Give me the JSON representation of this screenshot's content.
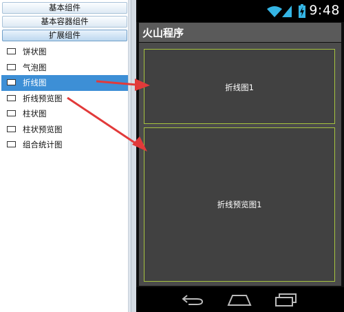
{
  "palette": {
    "categories": [
      {
        "label": "基本组件",
        "active": false
      },
      {
        "label": "基本容器组件",
        "active": false
      },
      {
        "label": "扩展组件",
        "active": true
      }
    ],
    "components": [
      {
        "label": "饼状图",
        "icon": "component-icon",
        "selected": false
      },
      {
        "label": "气泡图",
        "icon": "component-icon",
        "selected": false
      },
      {
        "label": "折线图",
        "icon": "component-icon",
        "selected": true
      },
      {
        "label": "折线预览图",
        "icon": "component-icon",
        "selected": false
      },
      {
        "label": "柱状图",
        "icon": "component-icon",
        "selected": false
      },
      {
        "label": "柱状预览图",
        "icon": "component-icon",
        "selected": false
      },
      {
        "label": "组合统计图",
        "icon": "component-icon",
        "selected": false
      }
    ]
  },
  "phone": {
    "status_bar": {
      "time": "9:48",
      "icons": [
        "wifi-icon",
        "signal-icon",
        "battery-charging-icon"
      ]
    },
    "app_title": "火山程序",
    "widgets": {
      "line_chart": "折线图1",
      "line_preview_chart": "折线预览图1"
    },
    "nav_icons": [
      "back-icon",
      "home-icon",
      "recent-apps-icon"
    ]
  },
  "colors": {
    "selection": "#3d8fd6",
    "widget_border": "#a7c43f",
    "arrow": "#e23a3a",
    "phone_content": "#4b4b4b"
  }
}
